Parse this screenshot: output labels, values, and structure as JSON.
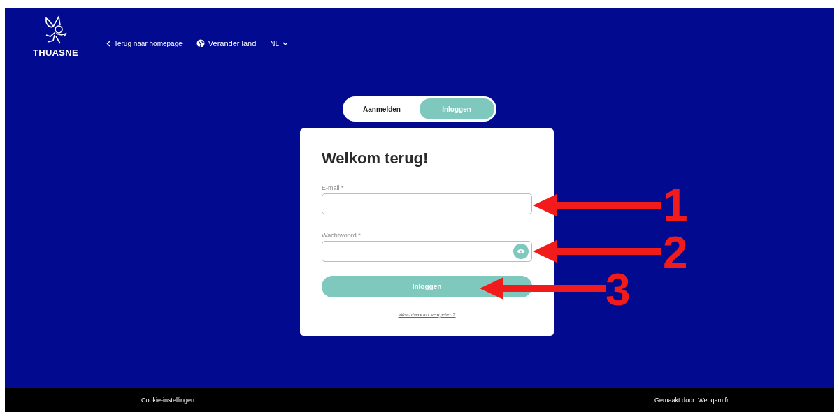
{
  "header": {
    "logo_text": "THUASNE",
    "back_link": "Terug naar homepage",
    "country_link": "Verander land",
    "language": "NL"
  },
  "tabs": [
    {
      "label": "Aanmelden",
      "selected": false
    },
    {
      "label": "Inloggen",
      "selected": true
    }
  ],
  "form": {
    "title": "Welkom terug!",
    "fields": [
      {
        "label": "E-mail *",
        "kind": "text"
      },
      {
        "label": "Wachtwoord *",
        "kind": "password"
      }
    ],
    "submit": "Inloggen",
    "forgot_link": "Wachtwoord vergeten?"
  },
  "annotations": [
    {
      "label": "1"
    },
    {
      "label": "2"
    },
    {
      "label": "3"
    }
  ],
  "footer": {
    "left": "Cookie-instellingen",
    "right": "Gemaakt door: Webqam.fr"
  }
}
